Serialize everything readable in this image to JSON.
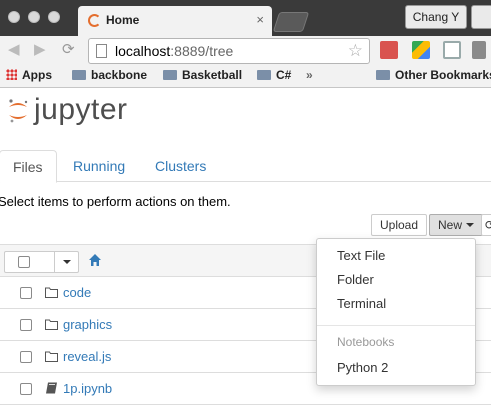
{
  "browser": {
    "tab_title": "Home",
    "tab_close": "×",
    "profile_name": "Chang Y",
    "url_host": "localhost",
    "url_rest": ":8889/tree",
    "bookmarks": [
      "Apps",
      "backbone",
      "Basketball",
      "C#"
    ],
    "other_bookmarks": "Other Bookmarks"
  },
  "jupyter": {
    "logo_text": "jupyter",
    "tabs": [
      "Files",
      "Running",
      "Clusters"
    ],
    "help_text": "Select items to perform actions on them.",
    "upload_label": "Upload",
    "new_label": "New",
    "items": [
      {
        "name": "code",
        "type": "folder"
      },
      {
        "name": "graphics",
        "type": "folder"
      },
      {
        "name": "reveal.js",
        "type": "folder"
      },
      {
        "name": "1p.ipynb",
        "type": "notebook"
      }
    ]
  },
  "new_menu": {
    "items": [
      "Text File",
      "Folder",
      "Terminal"
    ],
    "section_header": "Notebooks",
    "kernels": [
      "Python 2"
    ]
  },
  "colors": {
    "link": "#337ab7",
    "jupyter_orange": "#e46e2e",
    "chrome_dark": "#3a3a3a"
  }
}
